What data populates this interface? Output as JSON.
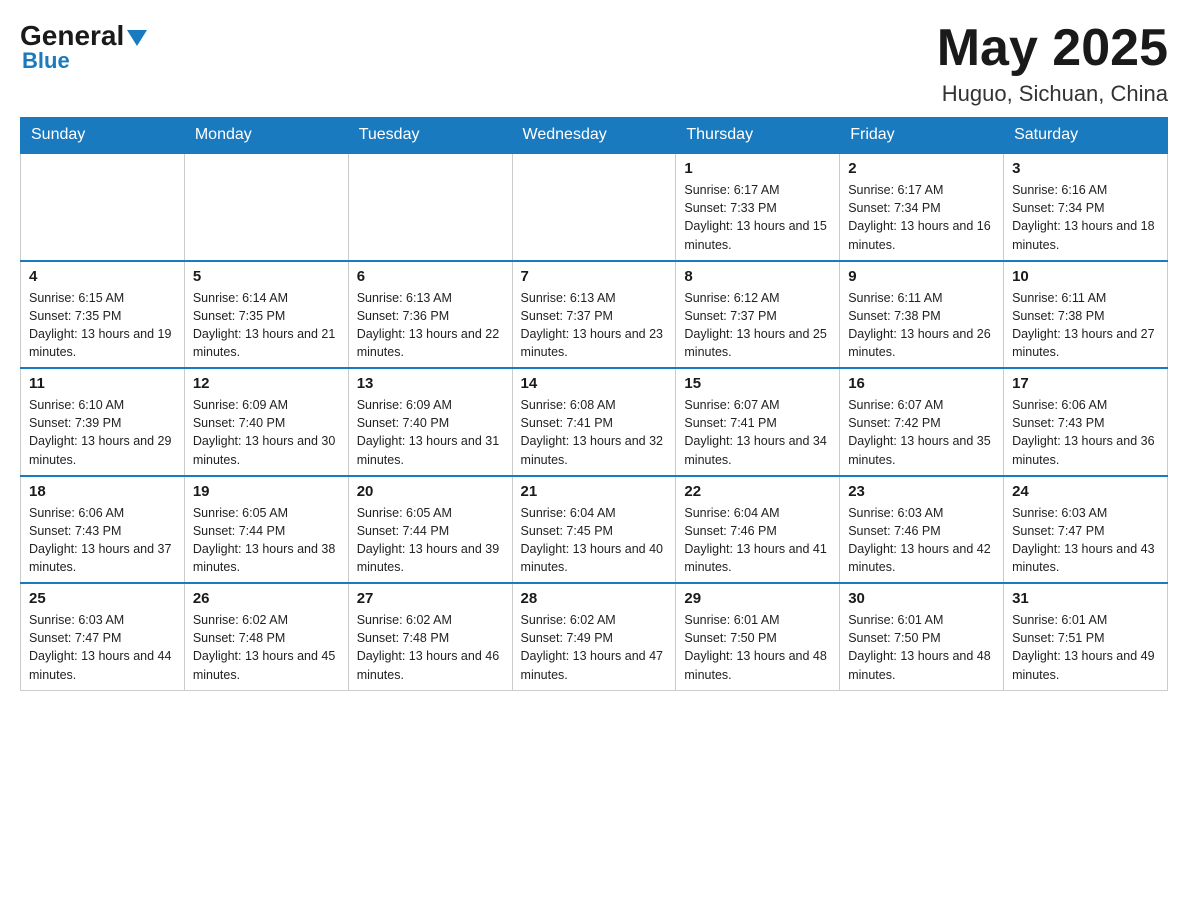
{
  "header": {
    "logo_general": "General",
    "logo_blue": "Blue",
    "month_year": "May 2025",
    "location": "Huguo, Sichuan, China"
  },
  "days_of_week": [
    "Sunday",
    "Monday",
    "Tuesday",
    "Wednesday",
    "Thursday",
    "Friday",
    "Saturday"
  ],
  "weeks": [
    [
      {
        "day": "",
        "info": ""
      },
      {
        "day": "",
        "info": ""
      },
      {
        "day": "",
        "info": ""
      },
      {
        "day": "",
        "info": ""
      },
      {
        "day": "1",
        "info": "Sunrise: 6:17 AM\nSunset: 7:33 PM\nDaylight: 13 hours and 15 minutes."
      },
      {
        "day": "2",
        "info": "Sunrise: 6:17 AM\nSunset: 7:34 PM\nDaylight: 13 hours and 16 minutes."
      },
      {
        "day": "3",
        "info": "Sunrise: 6:16 AM\nSunset: 7:34 PM\nDaylight: 13 hours and 18 minutes."
      }
    ],
    [
      {
        "day": "4",
        "info": "Sunrise: 6:15 AM\nSunset: 7:35 PM\nDaylight: 13 hours and 19 minutes."
      },
      {
        "day": "5",
        "info": "Sunrise: 6:14 AM\nSunset: 7:35 PM\nDaylight: 13 hours and 21 minutes."
      },
      {
        "day": "6",
        "info": "Sunrise: 6:13 AM\nSunset: 7:36 PM\nDaylight: 13 hours and 22 minutes."
      },
      {
        "day": "7",
        "info": "Sunrise: 6:13 AM\nSunset: 7:37 PM\nDaylight: 13 hours and 23 minutes."
      },
      {
        "day": "8",
        "info": "Sunrise: 6:12 AM\nSunset: 7:37 PM\nDaylight: 13 hours and 25 minutes."
      },
      {
        "day": "9",
        "info": "Sunrise: 6:11 AM\nSunset: 7:38 PM\nDaylight: 13 hours and 26 minutes."
      },
      {
        "day": "10",
        "info": "Sunrise: 6:11 AM\nSunset: 7:38 PM\nDaylight: 13 hours and 27 minutes."
      }
    ],
    [
      {
        "day": "11",
        "info": "Sunrise: 6:10 AM\nSunset: 7:39 PM\nDaylight: 13 hours and 29 minutes."
      },
      {
        "day": "12",
        "info": "Sunrise: 6:09 AM\nSunset: 7:40 PM\nDaylight: 13 hours and 30 minutes."
      },
      {
        "day": "13",
        "info": "Sunrise: 6:09 AM\nSunset: 7:40 PM\nDaylight: 13 hours and 31 minutes."
      },
      {
        "day": "14",
        "info": "Sunrise: 6:08 AM\nSunset: 7:41 PM\nDaylight: 13 hours and 32 minutes."
      },
      {
        "day": "15",
        "info": "Sunrise: 6:07 AM\nSunset: 7:41 PM\nDaylight: 13 hours and 34 minutes."
      },
      {
        "day": "16",
        "info": "Sunrise: 6:07 AM\nSunset: 7:42 PM\nDaylight: 13 hours and 35 minutes."
      },
      {
        "day": "17",
        "info": "Sunrise: 6:06 AM\nSunset: 7:43 PM\nDaylight: 13 hours and 36 minutes."
      }
    ],
    [
      {
        "day": "18",
        "info": "Sunrise: 6:06 AM\nSunset: 7:43 PM\nDaylight: 13 hours and 37 minutes."
      },
      {
        "day": "19",
        "info": "Sunrise: 6:05 AM\nSunset: 7:44 PM\nDaylight: 13 hours and 38 minutes."
      },
      {
        "day": "20",
        "info": "Sunrise: 6:05 AM\nSunset: 7:44 PM\nDaylight: 13 hours and 39 minutes."
      },
      {
        "day": "21",
        "info": "Sunrise: 6:04 AM\nSunset: 7:45 PM\nDaylight: 13 hours and 40 minutes."
      },
      {
        "day": "22",
        "info": "Sunrise: 6:04 AM\nSunset: 7:46 PM\nDaylight: 13 hours and 41 minutes."
      },
      {
        "day": "23",
        "info": "Sunrise: 6:03 AM\nSunset: 7:46 PM\nDaylight: 13 hours and 42 minutes."
      },
      {
        "day": "24",
        "info": "Sunrise: 6:03 AM\nSunset: 7:47 PM\nDaylight: 13 hours and 43 minutes."
      }
    ],
    [
      {
        "day": "25",
        "info": "Sunrise: 6:03 AM\nSunset: 7:47 PM\nDaylight: 13 hours and 44 minutes."
      },
      {
        "day": "26",
        "info": "Sunrise: 6:02 AM\nSunset: 7:48 PM\nDaylight: 13 hours and 45 minutes."
      },
      {
        "day": "27",
        "info": "Sunrise: 6:02 AM\nSunset: 7:48 PM\nDaylight: 13 hours and 46 minutes."
      },
      {
        "day": "28",
        "info": "Sunrise: 6:02 AM\nSunset: 7:49 PM\nDaylight: 13 hours and 47 minutes."
      },
      {
        "day": "29",
        "info": "Sunrise: 6:01 AM\nSunset: 7:50 PM\nDaylight: 13 hours and 48 minutes."
      },
      {
        "day": "30",
        "info": "Sunrise: 6:01 AM\nSunset: 7:50 PM\nDaylight: 13 hours and 48 minutes."
      },
      {
        "day": "31",
        "info": "Sunrise: 6:01 AM\nSunset: 7:51 PM\nDaylight: 13 hours and 49 minutes."
      }
    ]
  ]
}
